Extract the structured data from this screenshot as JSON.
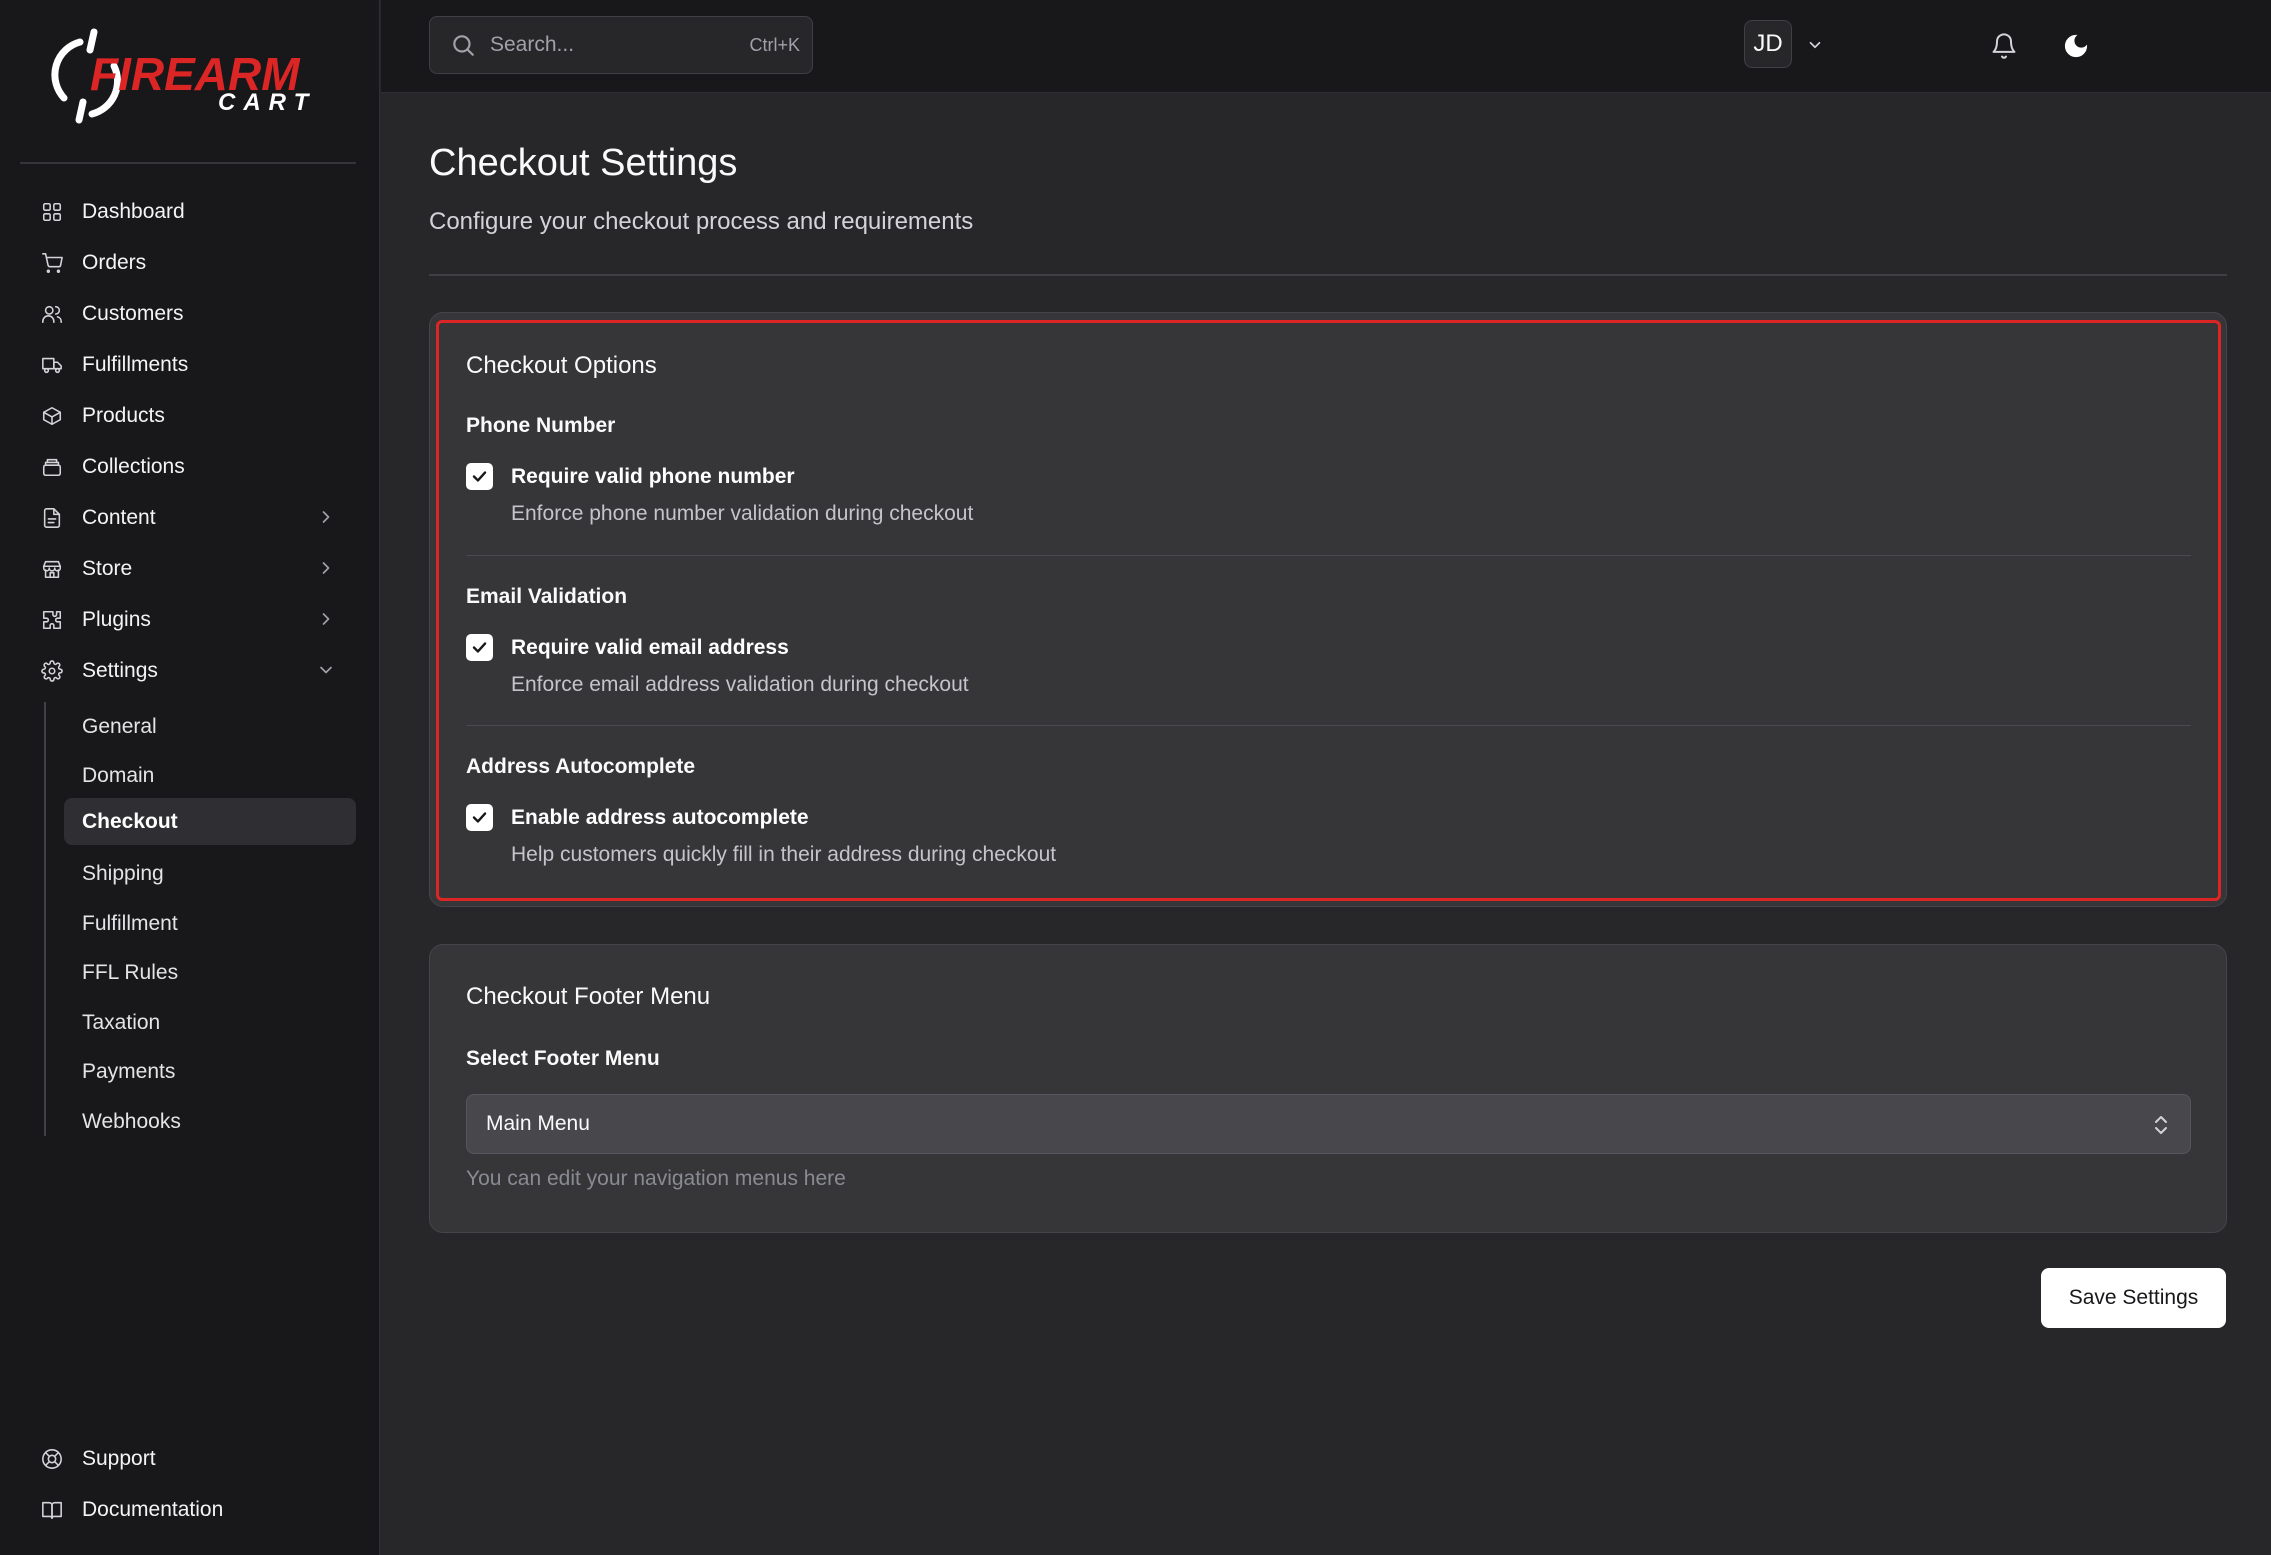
{
  "brand": {
    "name_top": "FIREARM",
    "name_bottom": "CART",
    "accent": "#dc2626"
  },
  "search": {
    "placeholder": "Search...",
    "shortcut": "Ctrl+K"
  },
  "user": {
    "initials": "JD"
  },
  "sidebar": {
    "items": [
      {
        "label": "Dashboard",
        "icon": "grid-icon"
      },
      {
        "label": "Orders",
        "icon": "cart-icon"
      },
      {
        "label": "Customers",
        "icon": "users-icon"
      },
      {
        "label": "Fulfillments",
        "icon": "truck-icon"
      },
      {
        "label": "Products",
        "icon": "box-icon"
      },
      {
        "label": "Collections",
        "icon": "stack-icon"
      },
      {
        "label": "Content",
        "icon": "file-icon",
        "expandable": true
      },
      {
        "label": "Store",
        "icon": "store-icon",
        "expandable": true
      },
      {
        "label": "Plugins",
        "icon": "puzzle-icon",
        "expandable": true
      },
      {
        "label": "Settings",
        "icon": "gear-icon",
        "expanded": true
      }
    ],
    "settings_children": [
      {
        "label": "General"
      },
      {
        "label": "Domain"
      },
      {
        "label": "Checkout",
        "active": true
      },
      {
        "label": "Shipping"
      },
      {
        "label": "Fulfillment"
      },
      {
        "label": "FFL Rules"
      },
      {
        "label": "Taxation"
      },
      {
        "label": "Payments"
      },
      {
        "label": "Webhooks"
      }
    ],
    "bottom": [
      {
        "label": "Support",
        "icon": "lifebuoy-icon"
      },
      {
        "label": "Documentation",
        "icon": "book-icon"
      }
    ]
  },
  "page": {
    "title": "Checkout Settings",
    "subtitle": "Configure your checkout process and requirements"
  },
  "checkout_options": {
    "title": "Checkout Options",
    "sections": [
      {
        "heading": "Phone Number",
        "checkbox_label": "Require valid phone number",
        "checked": true,
        "help": "Enforce phone number validation during checkout"
      },
      {
        "heading": "Email Validation",
        "checkbox_label": "Require valid email address",
        "checked": true,
        "help": "Enforce email address validation during checkout"
      },
      {
        "heading": "Address Autocomplete",
        "checkbox_label": "Enable address autocomplete",
        "checked": true,
        "help": "Help customers quickly fill in their address during checkout"
      }
    ]
  },
  "footer_menu": {
    "title": "Checkout Footer Menu",
    "select_label": "Select Footer Menu",
    "selected": "Main Menu",
    "help": "You can edit your navigation menus here"
  },
  "actions": {
    "save_label": "Save Settings"
  }
}
